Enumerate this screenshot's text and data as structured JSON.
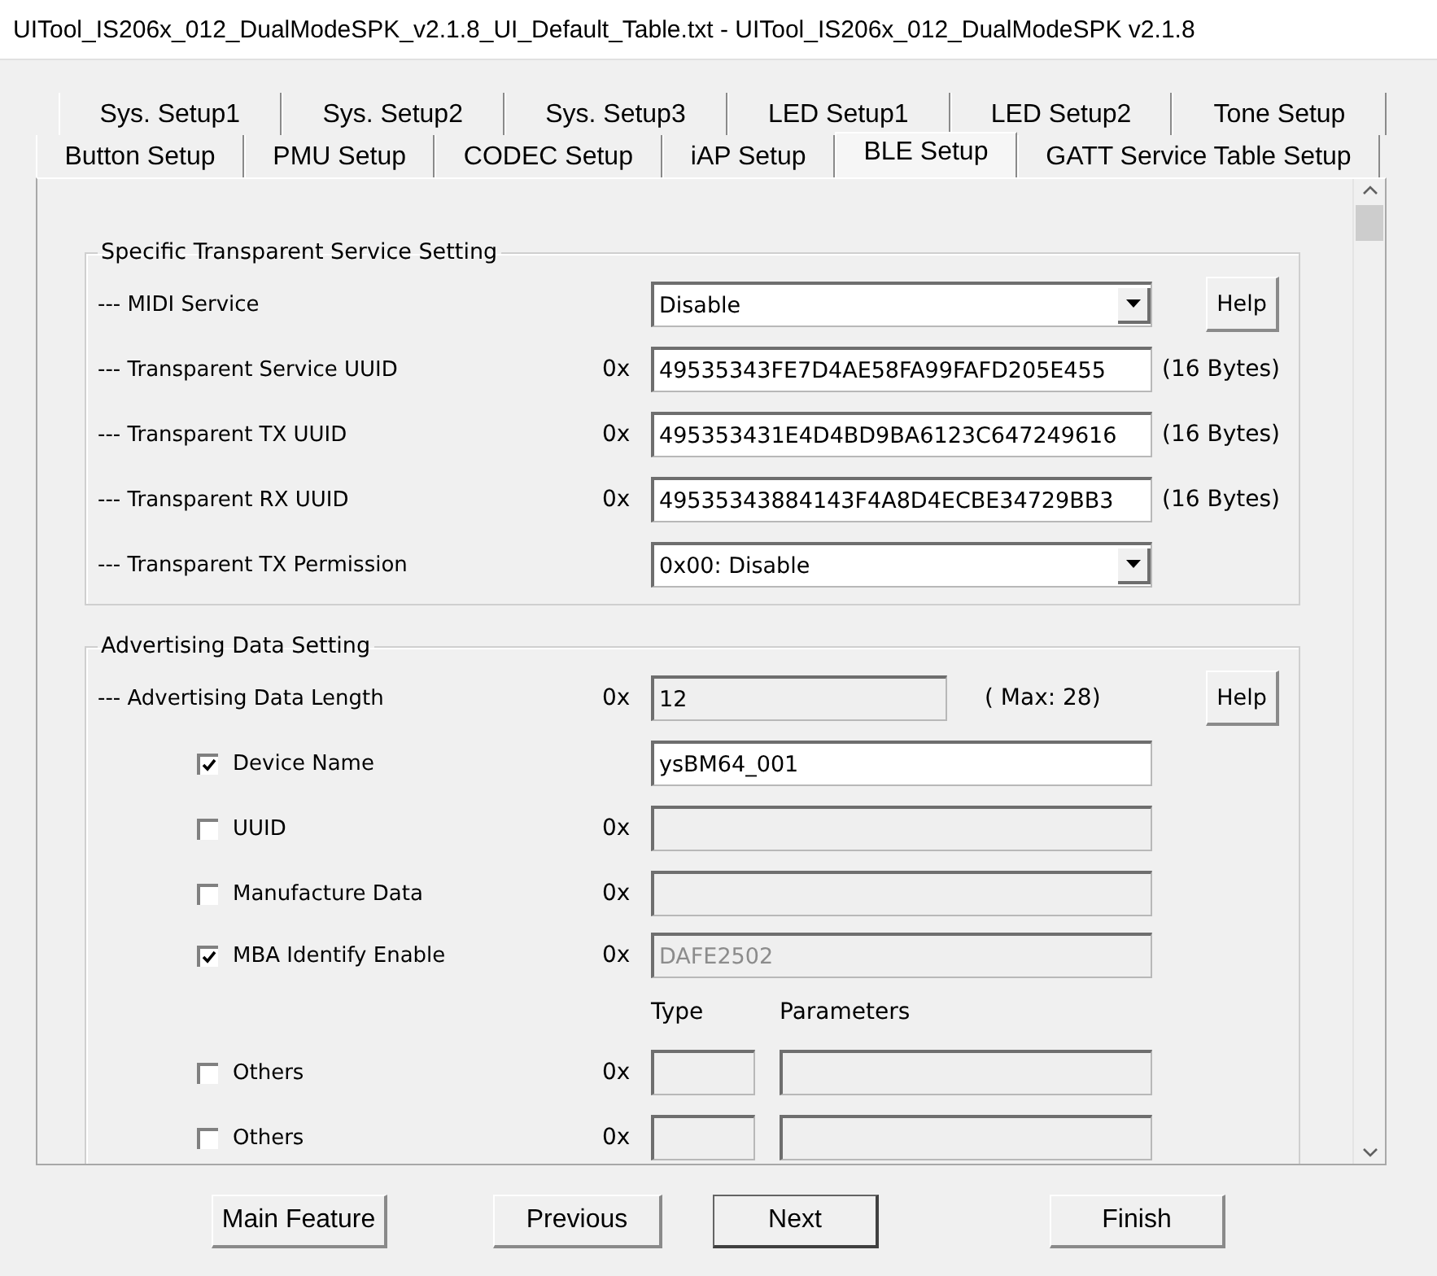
{
  "window": {
    "title": "UITool_IS206x_012_DualModeSPK_v2.1.8_UI_Default_Table.txt - UITool_IS206x_012_DualModeSPK v2.1.8"
  },
  "tab_rows": [
    [
      {
        "label": "Sys. Setup1",
        "selected": false
      },
      {
        "label": "Sys. Setup2",
        "selected": false
      },
      {
        "label": "Sys. Setup3",
        "selected": false
      },
      {
        "label": "LED Setup1",
        "selected": false
      },
      {
        "label": "LED Setup2",
        "selected": false
      },
      {
        "label": "Tone Setup",
        "selected": false
      }
    ],
    [
      {
        "label": "Button Setup",
        "selected": false
      },
      {
        "label": "PMU Setup",
        "selected": false
      },
      {
        "label": "CODEC Setup",
        "selected": false
      },
      {
        "label": "iAP Setup",
        "selected": false
      },
      {
        "label": "BLE Setup",
        "selected": true
      },
      {
        "label": "GATT Service Table Setup",
        "selected": false
      }
    ]
  ],
  "sections": [
    {
      "title": "Specific Transparent Service Setting",
      "rows": [
        {
          "kind": "select",
          "label": "--- MIDI Service",
          "value": "Disable",
          "help": "Help"
        },
        {
          "kind": "hex",
          "label": "--- Transparent Service UUID",
          "prefix": "0x",
          "value": "49535343FE7D4AE58FA99FAFD205E455",
          "suffix": "(16 Bytes)"
        },
        {
          "kind": "hex",
          "label": "--- Transparent TX UUID",
          "prefix": "0x",
          "value": "495353431E4D4BD9BA6123C647249616",
          "suffix": "(16 Bytes)"
        },
        {
          "kind": "hex",
          "label": "--- Transparent RX UUID",
          "prefix": "0x",
          "value": "49535343884143F4A8D4ECBE34729BB3",
          "suffix": "(16 Bytes)"
        },
        {
          "kind": "select",
          "label": "--- Transparent TX Permission",
          "value": "0x00: Disable"
        }
      ]
    },
    {
      "title": "Advertising Data Setting",
      "rows": [
        {
          "kind": "length",
          "label": "--- Advertising Data Length",
          "prefix": "0x",
          "value": "12",
          "note": "( Max: 28)",
          "help": "Help"
        },
        {
          "kind": "check",
          "label": "Device Name",
          "checked": true,
          "value": "ysBM64_001",
          "disabled": false
        },
        {
          "kind": "check",
          "label": "UUID",
          "checked": false,
          "prefix": "0x",
          "disabled": true
        },
        {
          "kind": "check",
          "label": "Manufacture Data",
          "checked": false,
          "prefix": "0x",
          "disabled": true
        },
        {
          "kind": "check",
          "label": "MBA Identify Enable",
          "checked": true,
          "prefix": "0x",
          "value": "DAFE2502",
          "disabled": true
        },
        {
          "kind": "header",
          "columns": [
            "Type",
            "Parameters"
          ]
        },
        {
          "kind": "check-pair",
          "label": "Others",
          "checked": false,
          "prefix": "0x",
          "disabled": true
        },
        {
          "kind": "check-pair",
          "label": "Others",
          "checked": false,
          "prefix": "0x",
          "disabled": true
        }
      ]
    }
  ],
  "buttons": [
    {
      "label": "Main Feature",
      "default": false
    },
    {
      "label": "Previous",
      "default": false
    },
    {
      "label": "Next",
      "default": true
    },
    {
      "label": "Finish",
      "default": false
    }
  ]
}
